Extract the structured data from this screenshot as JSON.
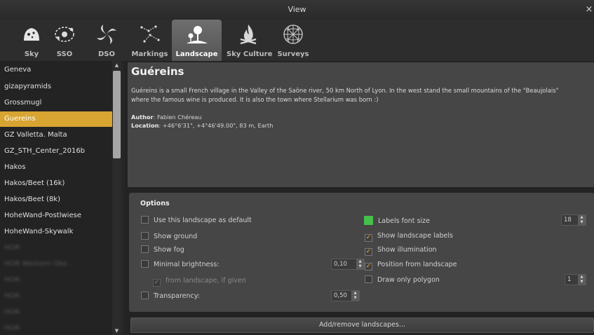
{
  "window": {
    "title": "View",
    "close_glyph": "×"
  },
  "tabs": [
    {
      "label": "Sky",
      "icon": "sky-icon"
    },
    {
      "label": "SSO",
      "icon": "sso-icon"
    },
    {
      "label": "DSO",
      "icon": "dso-icon"
    },
    {
      "label": "Markings",
      "icon": "markings-icon"
    },
    {
      "label": "Landscape",
      "icon": "landscape-icon",
      "active": true
    },
    {
      "label": "Sky Culture",
      "icon": "sky-culture-icon"
    },
    {
      "label": "Surveys",
      "icon": "surveys-icon"
    }
  ],
  "landscapes": [
    "Geneva",
    "gizapyramids",
    "Grossmugl",
    "Guereins",
    "GZ Valletta. Malta",
    "GZ_STH_Center_2016b",
    "Hakos",
    "Hakos/Beet (16k)",
    "Hakos/Beet (8k)",
    "HoheWand-Postlwiese",
    "HoheWand-Skywalk",
    "HOR",
    "HOR Western Obs...",
    "HOR",
    "HOR",
    "HOR",
    "HOR"
  ],
  "selected_landscape": "Guereins",
  "detail": {
    "name": "Guéreins",
    "description_line1": "Guéreins is a small French village in the Valley of the Saône river, 50 km North of Lyon. In the west stand the small mountains of the \"Beaujolais\"",
    "description_line2": "where the famous wine is produced. It is also the town where Stellarium was born :)",
    "author_label": "Author",
    "author": "Fabien Chéreau",
    "location_label": "Location",
    "location": "+46°6'31\", +4°46'49.00\", 83 m, Earth"
  },
  "options": {
    "title": "Options",
    "use_default": "Use this landscape as default",
    "show_ground": "Show ground",
    "show_fog": "Show fog",
    "minimal_brightness": "Minimal brightness:",
    "minimal_brightness_value": "0,10",
    "from_landscape": "from landscape, if given",
    "transparency": "Transparency:",
    "transparency_value": "0,50",
    "labels_font_size": "Labels font size",
    "labels_font_size_value": "18",
    "show_landscape_labels": "Show landscape labels",
    "show_illumination": "Show illumination",
    "position_from_landscape": "Position from landscape",
    "draw_only_polygon": "Draw only polygon",
    "polygon_value": "1",
    "check_glyph": "✓",
    "up_glyph": "▲",
    "down_glyph": "▼"
  },
  "add_remove_button": "Add/remove landscapes...",
  "colors": {
    "selection": "#d8a532",
    "label_color": "#45c04a",
    "check": "#f0b020"
  }
}
